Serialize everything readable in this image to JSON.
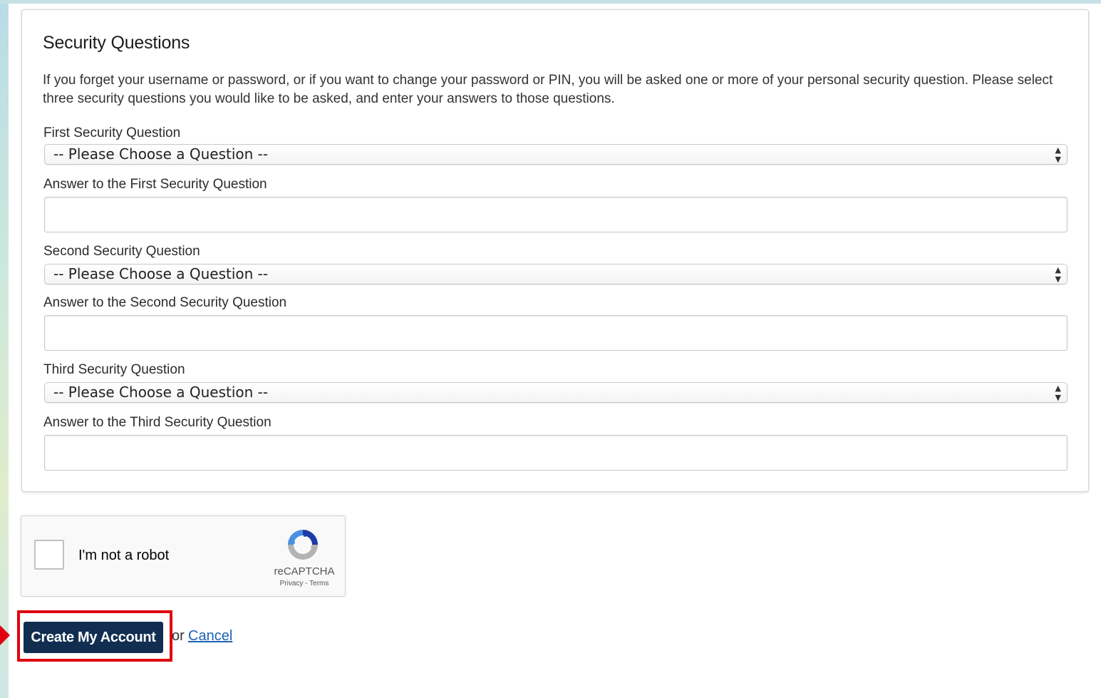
{
  "section": {
    "title": "Security Questions",
    "intro": "If you forget your username or password, or if you want to change your password or PIN, you will be asked one or more of your personal security question. Please select three security questions you would like to be asked, and enter your answers to those questions."
  },
  "questions": [
    {
      "question_label": "First Security Question",
      "selected_value": "-- Please Choose a Question --",
      "answer_label": "Answer to the First Security Question",
      "answer_value": ""
    },
    {
      "question_label": "Second Security Question",
      "selected_value": "-- Please Choose a Question --",
      "answer_label": "Answer to the Second Security Question",
      "answer_value": ""
    },
    {
      "question_label": "Third Security Question",
      "selected_value": "-- Please Choose a Question --",
      "answer_label": "Answer to the Third Security Question",
      "answer_value": ""
    }
  ],
  "captcha": {
    "label": "I'm not a robot",
    "brand": "reCAPTCHA",
    "links": "Privacy - Terms",
    "checked": false,
    "icon": "recaptcha-icon"
  },
  "actions": {
    "submit_label": "Create My Account",
    "or_text": "or",
    "cancel_label": "Cancel"
  },
  "icons": {
    "select_arrow": "up-down-arrows-icon",
    "pointer": "red-arrow-pointer-icon"
  },
  "colors": {
    "button_bg": "#112e51",
    "highlight": "#e0000f",
    "link": "#1c62b3",
    "captcha_blue": "#1c3aa9",
    "captcha_light": "#4a90e2",
    "captcha_gray": "#b3b3b3"
  }
}
